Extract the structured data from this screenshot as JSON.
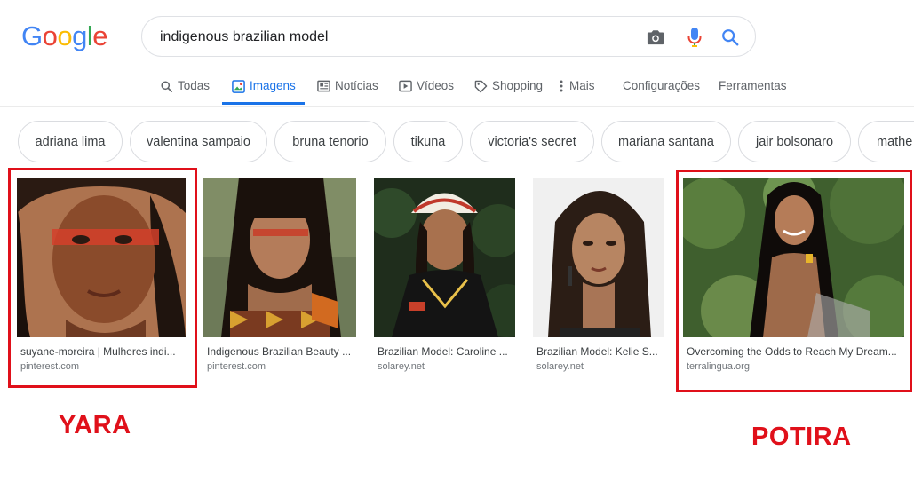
{
  "logo": {
    "letters": [
      "G",
      "o",
      "o",
      "g",
      "l",
      "e"
    ],
    "colors": [
      "#4285f4",
      "#ea4335",
      "#fbbc05",
      "#4285f4",
      "#34a853",
      "#ea4335"
    ]
  },
  "search": {
    "query": "indigenous brazilian model"
  },
  "icons": {
    "camera": "camera-icon",
    "mic": "microphone-icon",
    "search": "search-icon"
  },
  "tabs": [
    {
      "label": "Todas",
      "icon": "search-icon"
    },
    {
      "label": "Imagens",
      "icon": "image-icon",
      "active": true
    },
    {
      "label": "Notícias",
      "icon": "newspaper-icon"
    },
    {
      "label": "Vídeos",
      "icon": "play-icon"
    },
    {
      "label": "Shopping",
      "icon": "tag-icon"
    },
    {
      "label": "Mais",
      "icon": "more-vert-icon"
    },
    {
      "label": "Configurações"
    },
    {
      "label": "Ferramentas"
    }
  ],
  "chips": [
    "adriana lima",
    "valentina sampaio",
    "bruna tenorio",
    "tikuna",
    "victoria's secret",
    "mariana santana",
    "jair bolsonaro",
    "mathe"
  ],
  "results": [
    {
      "title": "suyane-moreira | Mulheres indi...",
      "source": "pinterest.com"
    },
    {
      "title": "Indigenous Brazilian Beauty ...",
      "source": "pinterest.com"
    },
    {
      "title": "Brazilian Model: Caroline ...",
      "source": "solarey.net"
    },
    {
      "title": "Brazilian Model: Kelie S...",
      "source": "solarey.net"
    },
    {
      "title": "Overcoming the Odds to Reach My Dream...",
      "source": "terralingua.org"
    }
  ],
  "annotations": {
    "left": "YARA",
    "right": "POTIRA"
  },
  "colors": {
    "accent": "#1a73e8",
    "annotation_red": "#e0101a"
  }
}
